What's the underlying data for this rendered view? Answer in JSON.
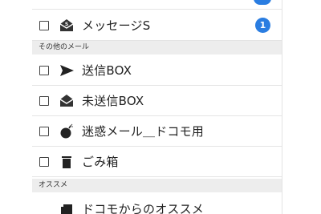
{
  "mail_list": {
    "folders": [
      {
        "label": "メッセージS",
        "icon": "envelope-s-icon",
        "badge": "1"
      },
      {
        "label": "送信BOX",
        "icon": "send-arrow-icon"
      },
      {
        "label": "未送信BOX",
        "icon": "envelope-open-icon"
      },
      {
        "label": "迷惑メール＿ドコモ用",
        "icon": "bomb-icon"
      },
      {
        "label": "ごみ箱",
        "icon": "trash-icon"
      },
      {
        "label": "ドコモからのオススメ",
        "icon": "recommend-icon"
      }
    ],
    "sections": {
      "other_mail": "その他のメール",
      "recommend": "オススメ"
    }
  },
  "colors": {
    "accent": "#2a7de1",
    "section_bg": "#ededed",
    "divider": "#e4e4e4"
  }
}
